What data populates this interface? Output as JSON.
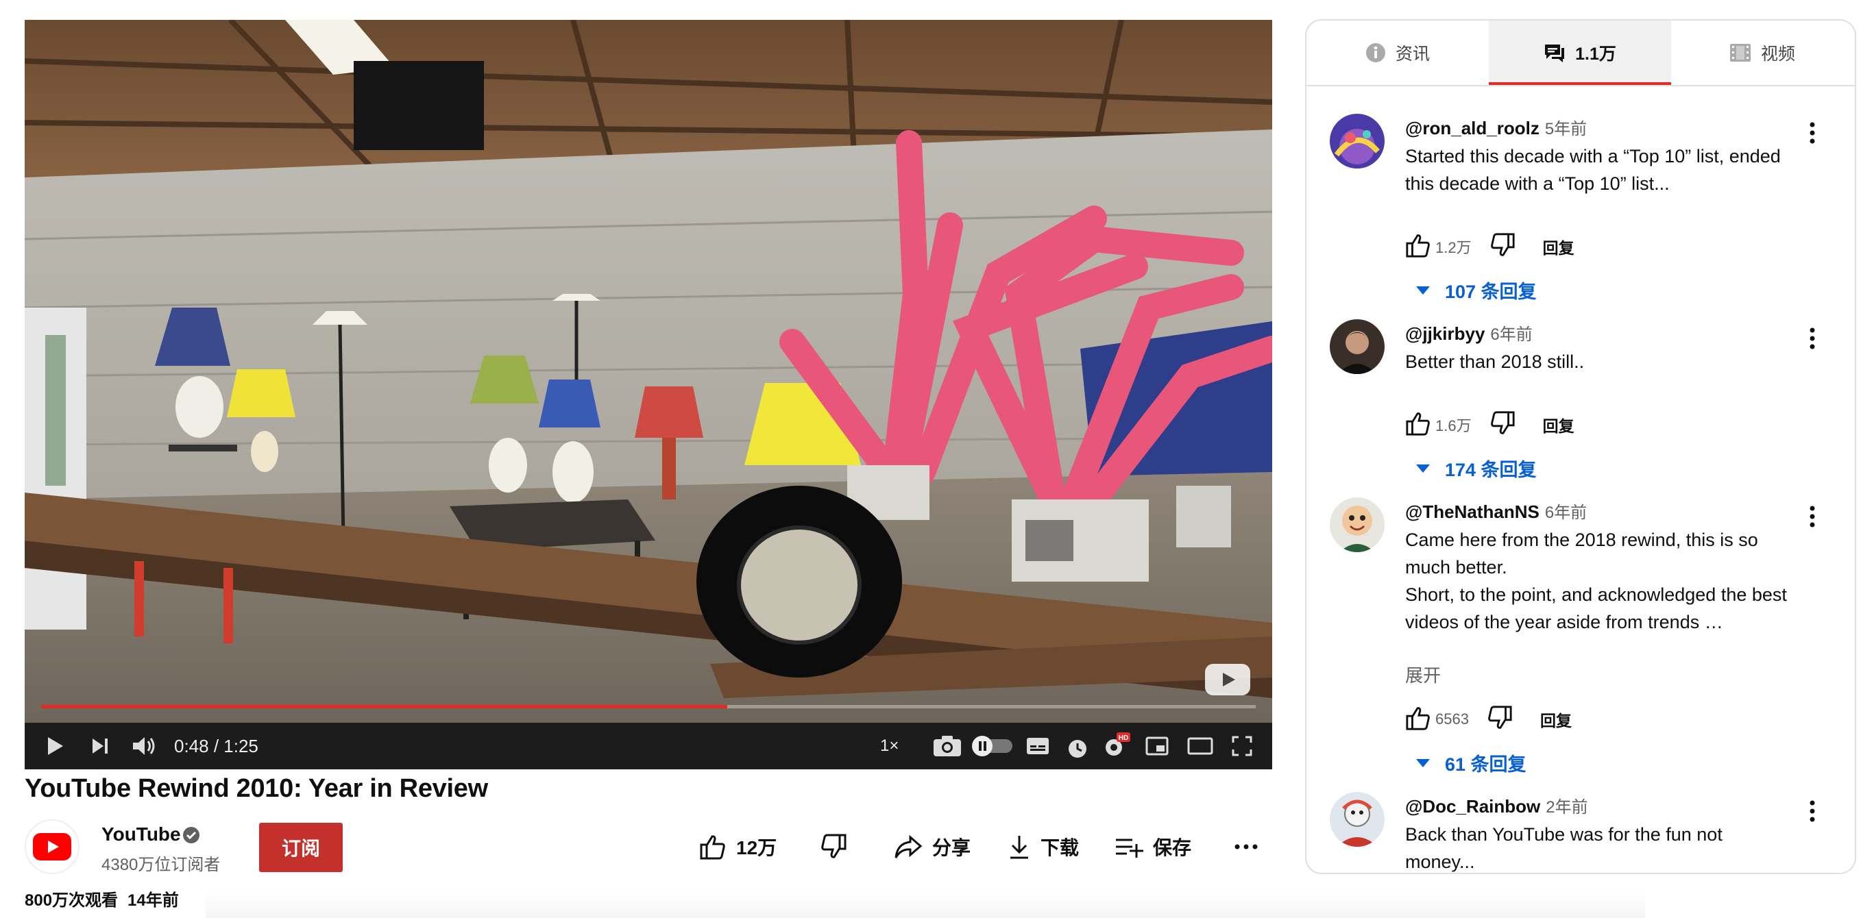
{
  "player": {
    "time": "0:48 / 1:25",
    "progress_fraction": 0.565,
    "speed": "1×",
    "hd_badge": "HD",
    "icons": [
      "play-icon",
      "next-icon",
      "volume-icon",
      "screenshot-icon",
      "autoplay-toggle",
      "subtitles-icon",
      "sleep-timer-icon",
      "settings-icon",
      "miniplayer-icon",
      "theater-icon",
      "fullscreen-icon"
    ]
  },
  "video": {
    "title": "YouTube Rewind 2010: Year in Review",
    "views": "800万次观看",
    "age": "14年前"
  },
  "channel": {
    "name": "YouTube",
    "subscribers": "4380万位订阅者",
    "subscribe_label": "订阅"
  },
  "actions": {
    "likes": "12万",
    "share": "分享",
    "download": "下载",
    "save": "保存"
  },
  "panel": {
    "tabs": [
      {
        "label": "资讯",
        "icon": "info-icon"
      },
      {
        "label": "1.1万",
        "icon": "comments-icon",
        "active": true
      },
      {
        "label": "视频",
        "icon": "video-icon"
      }
    ],
    "reply_label": "回复",
    "comments": [
      {
        "author": "@ron_ald_roolz",
        "when": "5年前",
        "text": "Started this decade with a “Top 10” list, ended this decade with a “Top 10” list...",
        "likes": "1.2万",
        "replies": "107 条回复"
      },
      {
        "author": "@jjkirbyy",
        "when": "6年前",
        "text": "Better than 2018 still..",
        "likes": "1.6万",
        "replies": "174 条回复"
      },
      {
        "author": "@TheNathanNS",
        "when": "6年前",
        "text": "Came here from the 2018 rewind, this is so much better.\nShort, to the point, and acknowledged the best videos of the year aside from trends …",
        "expand": "展开",
        "likes": "6563",
        "replies": "61 条回复"
      },
      {
        "author": "@Doc_Rainbow",
        "when": "2年前",
        "text": "Back than YouTube was for the fun not money..."
      }
    ]
  },
  "colors": {
    "accent_red": "#e32b2b",
    "subscribe_red": "#c4302b",
    "link_blue": "#065fd4"
  }
}
